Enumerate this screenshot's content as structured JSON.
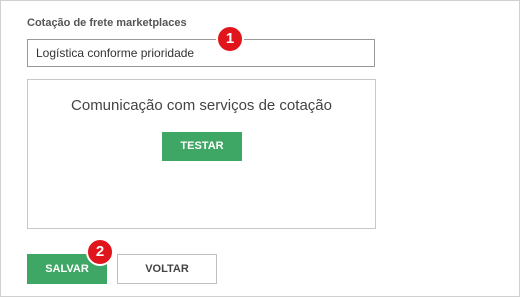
{
  "section": {
    "title": "Cotação de frete marketplaces"
  },
  "logistics_select": {
    "value": "Logística conforme prioridade"
  },
  "test_box": {
    "title": "Comunicação com serviços de cotação",
    "test_button": "TESTAR"
  },
  "actions": {
    "save_label": "SALVAR",
    "back_label": "VOLTAR"
  },
  "markers": [
    "1",
    "2"
  ],
  "colors": {
    "accent_green": "#3ea765",
    "marker_red": "#e0161c"
  }
}
